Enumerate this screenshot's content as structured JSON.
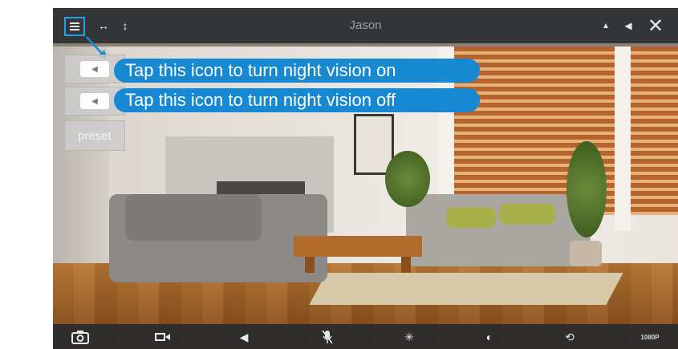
{
  "window": {
    "title": "Jason"
  },
  "top_bar": {
    "icons": [
      "menu-icon",
      "horizontal-expand-icon",
      "vertical-expand-icon",
      "triangle-up-icon",
      "speaker-icon",
      "close-icon"
    ]
  },
  "side_panel": {
    "buttons": [
      {
        "icon": "night-vision-on-icon"
      },
      {
        "icon": "night-vision-off-icon"
      },
      {
        "label": "preset"
      }
    ]
  },
  "callouts": {
    "night_vision_on": "Tap this icon to turn night vision on",
    "night_vision_off": "Tap this icon to turn night vision off"
  },
  "bottom_bar": {
    "items": [
      {
        "icon": "camera-icon"
      },
      {
        "icon": "video-record-icon"
      },
      {
        "icon": "speaker-icon"
      },
      {
        "icon": "microphone-icon"
      },
      {
        "icon": "brightness-icon"
      },
      {
        "icon": "contrast-icon"
      },
      {
        "icon": "reset-icon"
      },
      {
        "label": "1080P"
      }
    ]
  },
  "colors": {
    "accent": "#1788d2",
    "bar": "#2a2c30"
  }
}
